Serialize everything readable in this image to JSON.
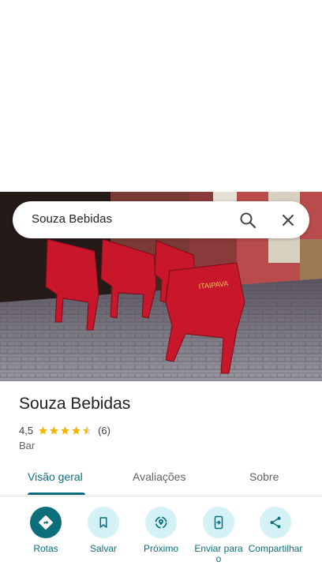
{
  "search": {
    "query": "Souza Bebidas"
  },
  "photo": {
    "sign_text": "ITAIPAVA"
  },
  "place": {
    "name": "Souza Bebidas",
    "rating": "4,5",
    "rating_value": 4.5,
    "review_count": "(6)",
    "category": "Bar"
  },
  "tabs": [
    {
      "label": "Visão geral",
      "active": true
    },
    {
      "label": "Avaliações",
      "active": false
    },
    {
      "label": "Sobre",
      "active": false
    }
  ],
  "actions": [
    {
      "label": "Rotas",
      "icon": "directions-icon"
    },
    {
      "label": "Salvar",
      "icon": "bookmark-icon"
    },
    {
      "label": "Próximo",
      "icon": "nearby-icon"
    },
    {
      "label": "Enviar para o",
      "icon": "send-to-phone-icon"
    },
    {
      "label": "Compartilhar",
      "icon": "share-icon"
    }
  ],
  "colors": {
    "accent": "#0b6e7a",
    "action_bg": "#d4f1f6",
    "star": "#f5b400"
  }
}
